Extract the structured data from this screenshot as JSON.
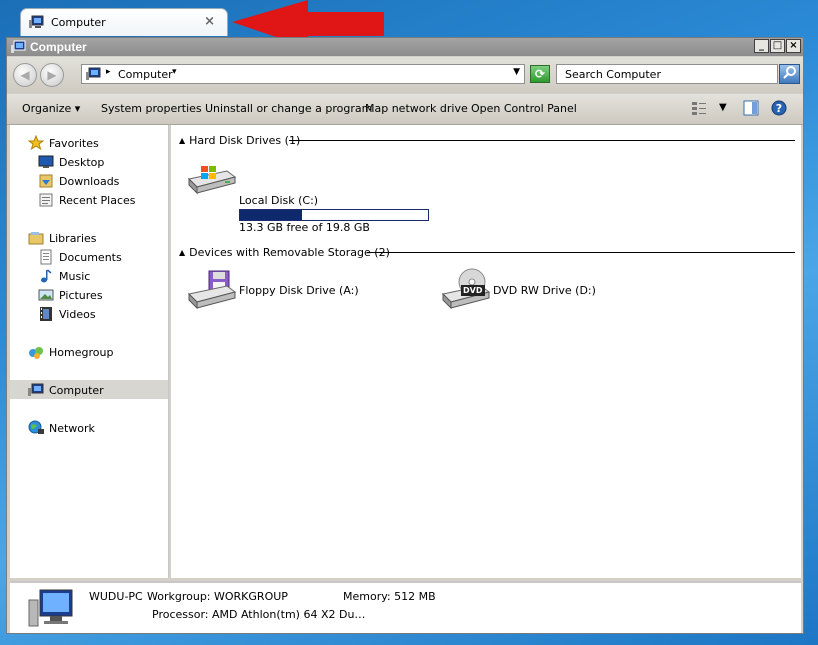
{
  "tab": {
    "label": "Computer",
    "close": "×"
  },
  "window": {
    "title": "Computer",
    "min": "_",
    "max": "□",
    "close": "×"
  },
  "address": {
    "location": "Computer",
    "search_placeholder": "Search Computer"
  },
  "toolbar": {
    "organize": "Organize",
    "system_properties": "System properties",
    "uninstall": "Uninstall or change a program",
    "map_drive": "Map network drive",
    "control_panel": "Open Control Panel"
  },
  "nav": {
    "favorites": "Favorites",
    "desktop": "Desktop",
    "downloads": "Downloads",
    "recent": "Recent Places",
    "libraries": "Libraries",
    "documents": "Documents",
    "music": "Music",
    "pictures": "Pictures",
    "videos": "Videos",
    "homegroup": "Homegroup",
    "computer": "Computer",
    "network": "Network"
  },
  "groups": {
    "hdd": {
      "title": "Hard Disk Drives (1)"
    },
    "removable": {
      "title": "Devices with Removable Storage (2)"
    }
  },
  "drives": {
    "c": {
      "name": "Local Disk (C:)",
      "free_text": "13.3 GB free of 19.8 GB",
      "used_fraction": 0.33
    },
    "a": {
      "name": "Floppy Disk Drive (A:)"
    },
    "d": {
      "name": "DVD RW Drive (D:)",
      "badge": "DVD"
    }
  },
  "details": {
    "pc_name": "WUDU-PC",
    "workgroup": "Workgroup: WORKGROUP",
    "memory": "Memory: 512 MB",
    "processor": "Processor: AMD Athlon(tm) 64 X2 Du…"
  },
  "colors": {
    "arrow": "#e01515",
    "bar_fill": "#0f2a6c"
  }
}
